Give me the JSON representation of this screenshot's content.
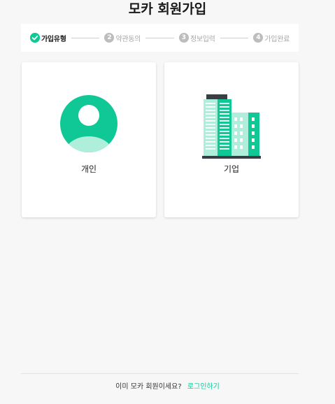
{
  "header": {
    "title": "모카 회원가입"
  },
  "steps": [
    {
      "label": "가입유형",
      "state": "done"
    },
    {
      "label": "약관동의",
      "number": "2",
      "state": "todo"
    },
    {
      "label": "정보입력",
      "number": "3",
      "state": "todo"
    },
    {
      "label": "가입완료",
      "number": "4",
      "state": "todo"
    }
  ],
  "cards": {
    "personal": {
      "label": "개인",
      "icon": "person-icon"
    },
    "business": {
      "label": "기업",
      "icon": "building-icon"
    }
  },
  "footer": {
    "question": "이미 모카 회원이세요?",
    "login_link": "로그인하기"
  },
  "colors": {
    "accent": "#10c896",
    "accent_light": "#aeeedb",
    "inactive": "#bdbdbd",
    "building_dark": "#3a3d45"
  }
}
